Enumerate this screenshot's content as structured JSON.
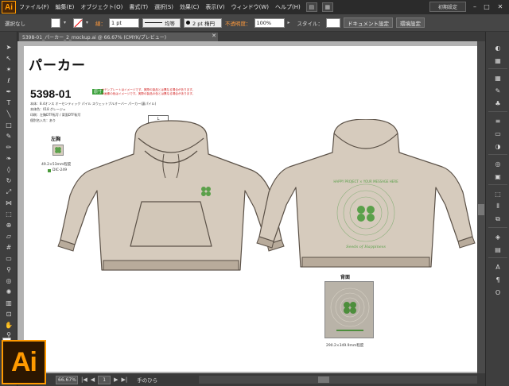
{
  "menubar": {
    "logo": "Ai",
    "items": [
      "ファイル(F)",
      "編集(E)",
      "オブジェクト(O)",
      "書式(T)",
      "選択(S)",
      "効果(C)",
      "表示(V)",
      "ウィンドウ(W)",
      "ヘルプ(H)"
    ],
    "workspace": "初期設定",
    "win_min": "–",
    "win_max": "□",
    "win_close": "✕"
  },
  "controlbar": {
    "selection": "選択なし",
    "stroke_label": "線：",
    "stroke_weight": "1 pt",
    "stroke_style": "均等",
    "brush": "2 pt 楕円",
    "opacity_label": "不透明度：",
    "opacity_value": "100%",
    "style_label": "スタイル：",
    "doc_setup": "ドキュメント設定",
    "prefs": "環境設定"
  },
  "document": {
    "tab_title": "5398-01_パーカー_2_mockup.ai @ 66.67% (CMYK/プレビュー)",
    "close": "✕"
  },
  "artboard": {
    "title": "パーカー",
    "product_code": "5398-01",
    "badge": "原寸",
    "note_line1": "※テンプレートはイメージです。実際の製品とは異なる場合があります。",
    "note_line2": "※画像の色はイメージです。実際の製品の色とは異なる場合があります。",
    "spec_body": "本体：8.4オンス オーセンティック パイル スウェットプルオーバー パーカー(裏パイル)",
    "spec_color": "本体色：018 グレージュ",
    "spec_print": "印刷：左胸DTF転写 / 背面DTF転写",
    "spec_name": "個別名入れ：あり",
    "size_tag": "L",
    "chest_label": "左胸",
    "chest_dims": "49.2×53mm程度",
    "chest_ink": "DIC-249",
    "back_label": "背面",
    "back_dims": "290.2×349.9mm程度",
    "back_text_top": "HAPPY PROJECT × YOUR MESSAGE HERE",
    "back_text_bottom": "Seeds of Happiness"
  },
  "statusbar": {
    "zoom": "66.67%",
    "first": "|◀",
    "prev": "◀",
    "page": "1",
    "next": "▶",
    "last": "▶|",
    "tool_name": "手のひら"
  },
  "colors": {
    "garment": "#d6cbbd",
    "garment_stroke": "#5b5147",
    "rib": "#b8ab9b",
    "print_green": "#5aa04a",
    "accent": "#ff9a00"
  },
  "icons": {
    "tools": [
      "selection-tool-icon",
      "direct-selection-tool-icon",
      "magic-wand-tool-icon",
      "lasso-tool-icon",
      "pen-tool-icon",
      "type-tool-icon",
      "line-tool-icon",
      "rectangle-tool-icon",
      "paintbrush-tool-icon",
      "pencil-tool-icon",
      "blob-brush-tool-icon",
      "eraser-tool-icon",
      "rotate-tool-icon",
      "scale-tool-icon",
      "width-tool-icon",
      "free-transform-tool-icon",
      "shape-builder-tool-icon",
      "perspective-grid-tool-icon",
      "mesh-tool-icon",
      "gradient-tool-icon",
      "eyedropper-tool-icon",
      "blend-tool-icon",
      "symbol-sprayer-tool-icon",
      "column-graph-tool-icon",
      "artboard-tool-icon",
      "slice-tool-icon",
      "hand-tool-icon",
      "zoom-tool-icon"
    ]
  }
}
